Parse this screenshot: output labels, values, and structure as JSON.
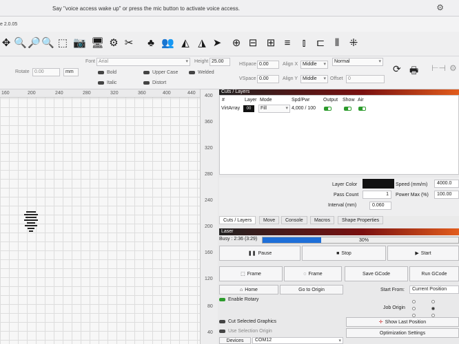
{
  "voice": {
    "banner": "Say \"voice access wake up\" or press the mic button to activate voice access."
  },
  "window": {
    "version": "e 2.0.05"
  },
  "toolbar": {
    "icons": [
      "move-icon",
      "zoom-in-icon",
      "zoom-fit-icon",
      "zoom-out-icon",
      "select-frame-icon",
      "camera-icon",
      "monitor-icon",
      "settings-icon",
      "tools-icon",
      "shapes-icon",
      "users-icon",
      "laser-icon",
      "mirror-icon",
      "send-icon",
      "target-icon",
      "align-icon",
      "distribute-icon",
      "equalize-icon",
      "spacing-icon",
      "snap-icon"
    ]
  },
  "fontbar": {
    "rotate_label": "Rotate",
    "rotate_value": "0.00",
    "unit": "mm",
    "font_label": "Font",
    "font_value": "Arial",
    "height_label": "Height",
    "height_value": "25.00",
    "hspace_label": "HSpace",
    "hspace_value": "0.00",
    "vspace_label": "VSpace",
    "vspace_value": "0.00",
    "alignx_label": "Align X",
    "alignx_value": "Middle",
    "aligny_label": "Align Y",
    "aligny_value": "Middle",
    "offset_label": "Offset",
    "offset_value": "0",
    "style_value": "Normal",
    "bold": "Bold",
    "italic": "Italic",
    "upper_case": "Upper Case",
    "distort": "Distort",
    "welded": "Welded"
  },
  "ruler": {
    "top": [
      "160",
      "200",
      "240",
      "280",
      "320",
      "360",
      "400",
      "440"
    ],
    "right": [
      "400",
      "360",
      "320",
      "280",
      "240",
      "200",
      "160",
      "120",
      "80",
      "40"
    ]
  },
  "cuts": {
    "header": "Cuts / Layers",
    "cols": [
      "#",
      "Layer",
      "Mode",
      "Spd/Pwr",
      "Output",
      "Show",
      "Air"
    ],
    "row": {
      "name": "VirtArray",
      "layer": "00",
      "mode": "Fill",
      "spd": "4,000 / 100"
    }
  },
  "props": {
    "layer_color": "Layer Color",
    "speed_label": "Speed (mm/m)",
    "speed_value": "4000.0",
    "pass_label": "Pass Count",
    "pass_value": "1",
    "power_label": "Power Max (%)",
    "power_value": "100.00",
    "interval_label": "Interval (mm)",
    "interval_value": "0.060"
  },
  "tabs": [
    "Cuts / Layers",
    "Move",
    "Console",
    "Macros",
    "Shape Properties"
  ],
  "laser": {
    "header": "Laser",
    "busy": "Busy : 2:36 (3:29)",
    "progress_pct": 30,
    "progress_text": "30%",
    "pause": "Pause",
    "stop": "Stop",
    "start": "Start",
    "frame1": "Frame",
    "frame2": "Frame",
    "save_gcode": "Save GCode",
    "run_gcode": "Run GCode",
    "home": "Home",
    "go_origin": "Go to Origin",
    "start_from_label": "Start From:",
    "start_from_value": "Current Position",
    "enable_rotary": "Enable Rotary",
    "job_origin": "Job Origin",
    "cut_selected": "Cut Selected Graphics",
    "use_selection": "Use Selection Origin",
    "show_last": "Show Last Position",
    "optimization": "Optimization Settings",
    "devices": "Devices",
    "port": "COM12"
  },
  "colors": {
    "accent": "#1e6fd9",
    "green": "#2c9b2c",
    "header_red": "#7a1010"
  }
}
